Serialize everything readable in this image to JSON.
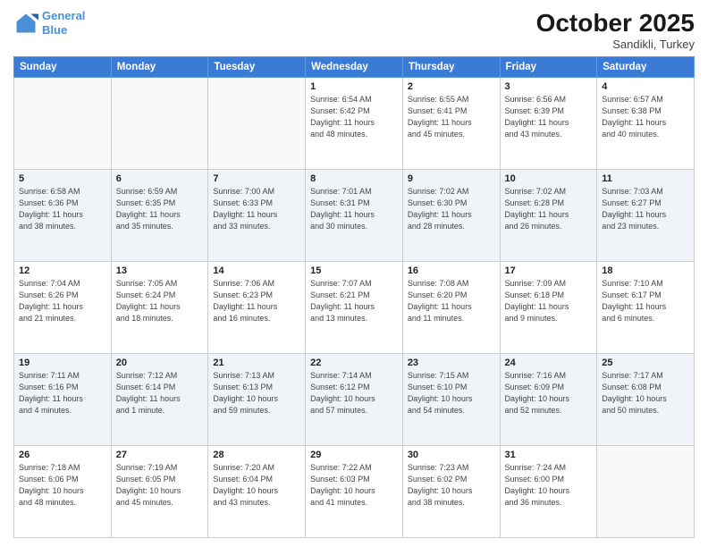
{
  "header": {
    "logo_line1": "General",
    "logo_line2": "Blue",
    "month": "October 2025",
    "location": "Sandikli, Turkey"
  },
  "days_of_week": [
    "Sunday",
    "Monday",
    "Tuesday",
    "Wednesday",
    "Thursday",
    "Friday",
    "Saturday"
  ],
  "rows": [
    [
      {
        "day": "",
        "info": ""
      },
      {
        "day": "",
        "info": ""
      },
      {
        "day": "",
        "info": ""
      },
      {
        "day": "1",
        "info": "Sunrise: 6:54 AM\nSunset: 6:42 PM\nDaylight: 11 hours\nand 48 minutes."
      },
      {
        "day": "2",
        "info": "Sunrise: 6:55 AM\nSunset: 6:41 PM\nDaylight: 11 hours\nand 45 minutes."
      },
      {
        "day": "3",
        "info": "Sunrise: 6:56 AM\nSunset: 6:39 PM\nDaylight: 11 hours\nand 43 minutes."
      },
      {
        "day": "4",
        "info": "Sunrise: 6:57 AM\nSunset: 6:38 PM\nDaylight: 11 hours\nand 40 minutes."
      }
    ],
    [
      {
        "day": "5",
        "info": "Sunrise: 6:58 AM\nSunset: 6:36 PM\nDaylight: 11 hours\nand 38 minutes."
      },
      {
        "day": "6",
        "info": "Sunrise: 6:59 AM\nSunset: 6:35 PM\nDaylight: 11 hours\nand 35 minutes."
      },
      {
        "day": "7",
        "info": "Sunrise: 7:00 AM\nSunset: 6:33 PM\nDaylight: 11 hours\nand 33 minutes."
      },
      {
        "day": "8",
        "info": "Sunrise: 7:01 AM\nSunset: 6:31 PM\nDaylight: 11 hours\nand 30 minutes."
      },
      {
        "day": "9",
        "info": "Sunrise: 7:02 AM\nSunset: 6:30 PM\nDaylight: 11 hours\nand 28 minutes."
      },
      {
        "day": "10",
        "info": "Sunrise: 7:02 AM\nSunset: 6:28 PM\nDaylight: 11 hours\nand 26 minutes."
      },
      {
        "day": "11",
        "info": "Sunrise: 7:03 AM\nSunset: 6:27 PM\nDaylight: 11 hours\nand 23 minutes."
      }
    ],
    [
      {
        "day": "12",
        "info": "Sunrise: 7:04 AM\nSunset: 6:26 PM\nDaylight: 11 hours\nand 21 minutes."
      },
      {
        "day": "13",
        "info": "Sunrise: 7:05 AM\nSunset: 6:24 PM\nDaylight: 11 hours\nand 18 minutes."
      },
      {
        "day": "14",
        "info": "Sunrise: 7:06 AM\nSunset: 6:23 PM\nDaylight: 11 hours\nand 16 minutes."
      },
      {
        "day": "15",
        "info": "Sunrise: 7:07 AM\nSunset: 6:21 PM\nDaylight: 11 hours\nand 13 minutes."
      },
      {
        "day": "16",
        "info": "Sunrise: 7:08 AM\nSunset: 6:20 PM\nDaylight: 11 hours\nand 11 minutes."
      },
      {
        "day": "17",
        "info": "Sunrise: 7:09 AM\nSunset: 6:18 PM\nDaylight: 11 hours\nand 9 minutes."
      },
      {
        "day": "18",
        "info": "Sunrise: 7:10 AM\nSunset: 6:17 PM\nDaylight: 11 hours\nand 6 minutes."
      }
    ],
    [
      {
        "day": "19",
        "info": "Sunrise: 7:11 AM\nSunset: 6:16 PM\nDaylight: 11 hours\nand 4 minutes."
      },
      {
        "day": "20",
        "info": "Sunrise: 7:12 AM\nSunset: 6:14 PM\nDaylight: 11 hours\nand 1 minute."
      },
      {
        "day": "21",
        "info": "Sunrise: 7:13 AM\nSunset: 6:13 PM\nDaylight: 10 hours\nand 59 minutes."
      },
      {
        "day": "22",
        "info": "Sunrise: 7:14 AM\nSunset: 6:12 PM\nDaylight: 10 hours\nand 57 minutes."
      },
      {
        "day": "23",
        "info": "Sunrise: 7:15 AM\nSunset: 6:10 PM\nDaylight: 10 hours\nand 54 minutes."
      },
      {
        "day": "24",
        "info": "Sunrise: 7:16 AM\nSunset: 6:09 PM\nDaylight: 10 hours\nand 52 minutes."
      },
      {
        "day": "25",
        "info": "Sunrise: 7:17 AM\nSunset: 6:08 PM\nDaylight: 10 hours\nand 50 minutes."
      }
    ],
    [
      {
        "day": "26",
        "info": "Sunrise: 7:18 AM\nSunset: 6:06 PM\nDaylight: 10 hours\nand 48 minutes."
      },
      {
        "day": "27",
        "info": "Sunrise: 7:19 AM\nSunset: 6:05 PM\nDaylight: 10 hours\nand 45 minutes."
      },
      {
        "day": "28",
        "info": "Sunrise: 7:20 AM\nSunset: 6:04 PM\nDaylight: 10 hours\nand 43 minutes."
      },
      {
        "day": "29",
        "info": "Sunrise: 7:22 AM\nSunset: 6:03 PM\nDaylight: 10 hours\nand 41 minutes."
      },
      {
        "day": "30",
        "info": "Sunrise: 7:23 AM\nSunset: 6:02 PM\nDaylight: 10 hours\nand 38 minutes."
      },
      {
        "day": "31",
        "info": "Sunrise: 7:24 AM\nSunset: 6:00 PM\nDaylight: 10 hours\nand 36 minutes."
      },
      {
        "day": "",
        "info": ""
      }
    ]
  ]
}
